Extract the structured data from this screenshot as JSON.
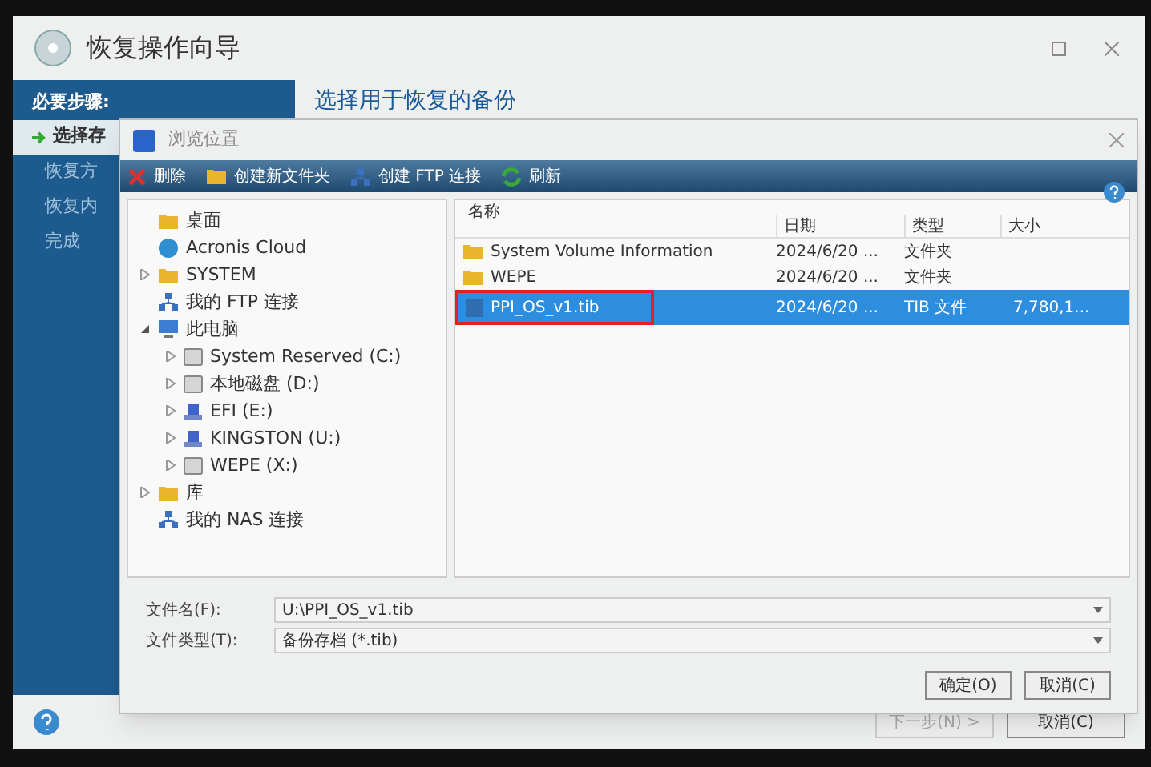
{
  "wizard": {
    "title": "恢复操作向导",
    "heading": "选择用于恢复的备份",
    "sidebar": {
      "header": "必要步骤:",
      "items": [
        {
          "label": "选择存",
          "selected": true
        },
        {
          "label": "恢复方",
          "selected": false
        },
        {
          "label": "恢复内",
          "selected": false
        },
        {
          "label": "完成",
          "selected": false
        }
      ]
    },
    "buttons": [
      {
        "label": "下一步(N) >",
        "disabled": true
      },
      {
        "label": "取消(C)",
        "disabled": false
      }
    ]
  },
  "dialog": {
    "title": "浏览位置",
    "toolbar": [
      {
        "label": "删除",
        "kind": "delete"
      },
      {
        "label": "创建新文件夹",
        "kind": "folder"
      },
      {
        "label": "创建 FTP 连接",
        "kind": "network"
      },
      {
        "label": "刷新",
        "kind": "refresh"
      }
    ],
    "tree": [
      {
        "label": "桌面",
        "kind": "folder"
      },
      {
        "label": "Acronis Cloud",
        "kind": "cloud"
      },
      {
        "label": "SYSTEM",
        "kind": "folder",
        "expanded": false
      },
      {
        "label": "我的 FTP 连接",
        "kind": "network"
      },
      {
        "label": "此电脑",
        "kind": "computer",
        "expanded": true,
        "children": [
          {
            "label": "System Reserved (C:)",
            "kind": "drive",
            "expanded": false
          },
          {
            "label": "本地磁盘 (D:)",
            "kind": "drive",
            "expanded": false
          },
          {
            "label": "EFI (E:)",
            "kind": "usb",
            "expanded": false
          },
          {
            "label": "KINGSTON (U:)",
            "kind": "usb",
            "expanded": false
          },
          {
            "label": "WEPE (X:)",
            "kind": "drive",
            "expanded": false
          }
        ]
      },
      {
        "label": "库",
        "kind": "folder",
        "expanded": false
      },
      {
        "label": "我的 NAS 连接",
        "kind": "network"
      }
    ],
    "columns": [
      "名称",
      "日期",
      "类型",
      "大小"
    ],
    "rows": [
      {
        "kind": "folder",
        "name": "System Volume Information",
        "date": "2024/6/20 ...",
        "type": "文件夹",
        "selected": false,
        "annotated": false
      },
      {
        "kind": "folder",
        "name": "WEPE",
        "date": "2024/6/20 ...",
        "type": "文件夹",
        "selected": false,
        "annotated": false
      },
      {
        "kind": "file",
        "name": "PPI_OS_v1.tib",
        "date": "2024/6/20 ...",
        "type": "TIB 文件",
        "size": "7,780,1...",
        "selected": true,
        "annotated": true
      }
    ],
    "fields": [
      {
        "label": "文件名(F):",
        "value": "U:\\PPI_OS_v1.tib"
      },
      {
        "label": "文件类型(T):",
        "value": "备份存档 (*.tib)"
      }
    ],
    "buttons": [
      "确定(O)",
      "取消(C)"
    ]
  }
}
